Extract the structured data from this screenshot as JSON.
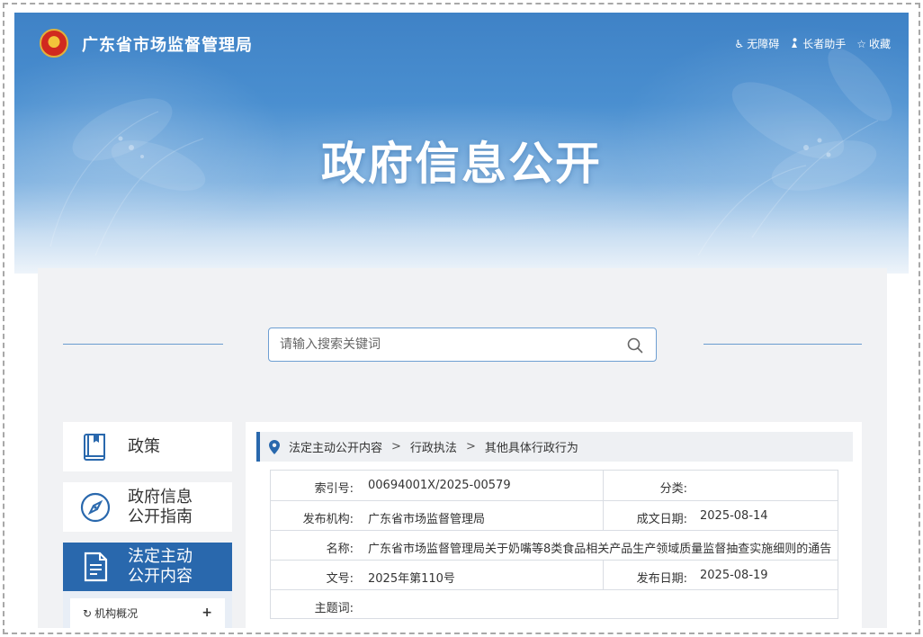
{
  "header": {
    "site_title": "广东省市场监督管理局",
    "links": [
      {
        "icon": "wheelchair-icon",
        "label": "无障碍"
      },
      {
        "icon": "elderly-assist-icon",
        "label": "长者助手"
      },
      {
        "icon": "star-icon",
        "label": "收藏"
      }
    ],
    "hero_title": "政府信息公开"
  },
  "search": {
    "placeholder": "请输入搜索关键词",
    "icon": "search-icon"
  },
  "sidebar": {
    "cards": [
      {
        "icon": "book-icon",
        "label_lines": [
          "政策"
        ],
        "active": false
      },
      {
        "icon": "compass-icon",
        "label_lines": [
          "政府信息",
          "公开指南"
        ],
        "active": false
      },
      {
        "icon": "document-icon",
        "label_lines": [
          "法定主动",
          "公开内容"
        ],
        "active": true
      }
    ],
    "sub_items": [
      {
        "icon": "refresh-icon",
        "label": "机构概况",
        "expand": "+"
      }
    ]
  },
  "breadcrumb": {
    "icon": "location-pin-icon",
    "items": [
      "法定主动公开内容",
      "行政执法",
      "其他具体行政行为"
    ],
    "separator": ">"
  },
  "info_table": {
    "index_label": "索引号:",
    "index_value": "00694001X/2025-00579",
    "category_label": "分类:",
    "category_value": "",
    "publisher_label": "发布机构:",
    "publisher_value": "广东省市场监督管理局",
    "created_label": "成文日期:",
    "created_value": "2025-08-14",
    "name_label": "名称:",
    "name_value": "广东省市场监督管理局关于奶嘴等8类食品相关产品生产领域质量监督抽查实施细则的通告",
    "docno_label": "文号:",
    "docno_value": "2025年第110号",
    "pubdate_label": "发布日期:",
    "pubdate_value": "2025-08-19",
    "subject_label": "主题词:",
    "subject_value": ""
  },
  "colors": {
    "brand_blue": "#2968ad",
    "banner_top": "#3f82c6",
    "panel_bg": "#f1f2f4"
  }
}
